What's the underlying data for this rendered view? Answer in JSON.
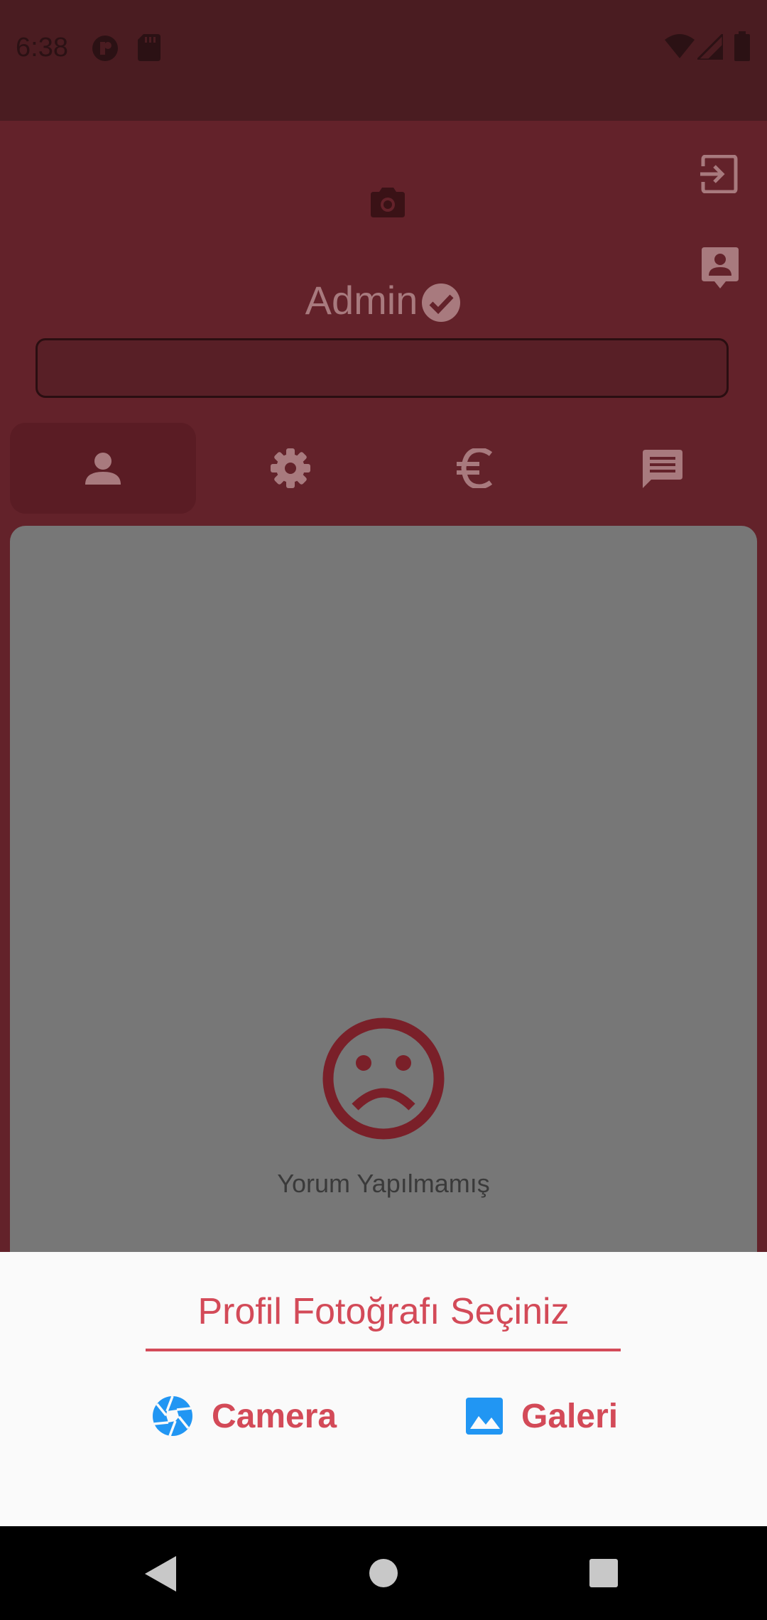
{
  "status_bar": {
    "time": "6:38",
    "icons": [
      "app-notification-icon",
      "sd-card-icon",
      "wifi-icon",
      "cellular-signal-icon",
      "battery-icon"
    ]
  },
  "profile": {
    "name": "Admin",
    "verified": true,
    "name_field_value": ""
  },
  "top_actions": [
    "camera-icon",
    "logout-icon",
    "contact-icon"
  ],
  "tabs": [
    {
      "icon": "person-icon",
      "active": true
    },
    {
      "icon": "settings-icon",
      "active": false
    },
    {
      "icon": "euro-icon",
      "active": false
    },
    {
      "icon": "comment-icon",
      "active": false
    }
  ],
  "empty_state": {
    "icon": "sad-face-icon",
    "text": "Yorum Yapılmamış"
  },
  "bottom_sheet": {
    "title": "Profil Fotoğrafı Seçiniz",
    "options": [
      {
        "label": "Camera",
        "icon": "camera-aperture-icon"
      },
      {
        "label": "Galeri",
        "icon": "gallery-image-icon"
      }
    ]
  },
  "colors": {
    "accent": "#d34a58",
    "icon_blue": "#2196f3",
    "scrim_app_bg": "#63222a",
    "status_bar_bg": "#4a1c21",
    "sheet_bg": "#fafafa"
  }
}
